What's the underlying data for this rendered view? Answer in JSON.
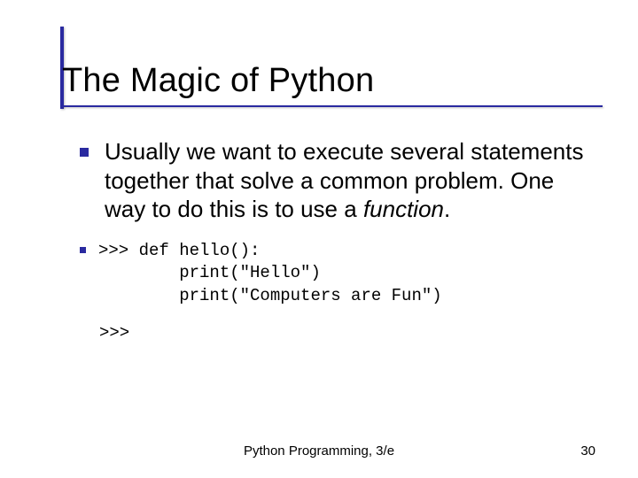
{
  "title": "The Magic of Python",
  "bullets": [
    {
      "text_plain": "Usually we want to execute several statements together that solve a common problem. One way to do this is to use a ",
      "text_italic": "function",
      "text_after": "."
    }
  ],
  "code": {
    "line1": ">>> def hello():",
    "line2": "        print(\"Hello\")",
    "line3": "        print(\"Computers are Fun\")",
    "prompt": ">>>"
  },
  "footer": {
    "center": "Python Programming, 3/e",
    "page": "30"
  }
}
